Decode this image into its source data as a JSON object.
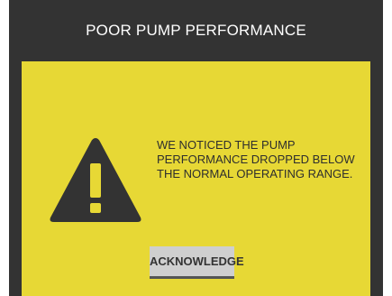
{
  "dialog": {
    "title": "POOR PUMP PERFORMANCE",
    "message": "WE NOTICED THE PUMP\nPERFORMANCE DROPPED BELOW\nTHE NORMAL OPERATING RANGE.",
    "icon": "warning-triangle-icon",
    "acknowledge_label": "ACKNOWLEDGE"
  },
  "colors": {
    "frame": "#333333",
    "panel": "#e7d835",
    "button": "#cfcfcf",
    "title_text": "#ffffff"
  }
}
